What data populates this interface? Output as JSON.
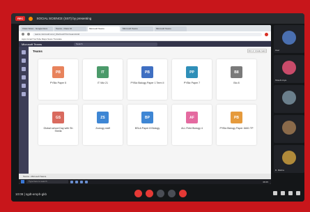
{
  "recording": {
    "badge": "REC",
    "title": "SOCIAL SCIENCE (SST) by presenting"
  },
  "browser": {
    "tabs": [
      "Class Notes - Google Docs",
      "Teams - Class 10",
      "Microsoft Teams",
      "Microsoft Teams",
      "Microsoft Teams"
    ],
    "url": "teams.microsoft.com/_#/school//?ctx=teamsGrid",
    "bookmarks": "Apps   Gmail   YouTube   Maps   News   Translate"
  },
  "teams": {
    "app_title": "Microsoft Teams",
    "search_placeholder": "Search",
    "heading": "Teams",
    "join_button": "Join or create team",
    "cards": [
      {
        "name": "PYBiz Paper 5",
        "color": "#e8835c",
        "initials": "PB"
      },
      {
        "name": "IT Wiz 21",
        "color": "#4b9a6a",
        "initials": "IT"
      },
      {
        "name": "PYBiz Biology Paper 1 Term II",
        "color": "#3f6fc2",
        "initials": "PB"
      },
      {
        "name": "PYBiz Paper 7",
        "color": "#2f8fb8",
        "initials": "PP"
      },
      {
        "name": "Bio 8",
        "color": "#7a7a7a",
        "initials": "B8"
      },
      {
        "name": "Global school Day with Sh Sheila",
        "color": "#d96a5e",
        "initials": "GS"
      },
      {
        "name": "Zoology staff",
        "color": "#3e86d4",
        "initials": "ZS"
      },
      {
        "name": "BSLA Paper 8 Biology",
        "color": "#3e86d4",
        "initials": "BP"
      },
      {
        "name": "ALL Field Biology 4",
        "color": "#e46aa0",
        "initials": "AF"
      },
      {
        "name": "PYBiz Biology Paper IAM1 TP",
        "color": "#e59a3c",
        "initials": "PB"
      }
    ],
    "notification": "Teams - Microsoft Teams",
    "taskbar_search": "Type here to search",
    "taskbar_clock": "08:45"
  },
  "participants": [
    {
      "name": "User",
      "avatar_color": "#4a6fb0"
    },
    {
      "name": "Shashi Arya",
      "avatar_color": "#c94b6a"
    },
    {
      "name": "",
      "avatar_color": "#6b7f8c"
    },
    {
      "name": "",
      "avatar_color": "#8a6a4a"
    },
    {
      "name": "D. Mishra",
      "avatar_color": "#b08a3a"
    }
  ],
  "zoom": {
    "meeting_label": "10:09  |  sgdt-emph-gkb"
  }
}
